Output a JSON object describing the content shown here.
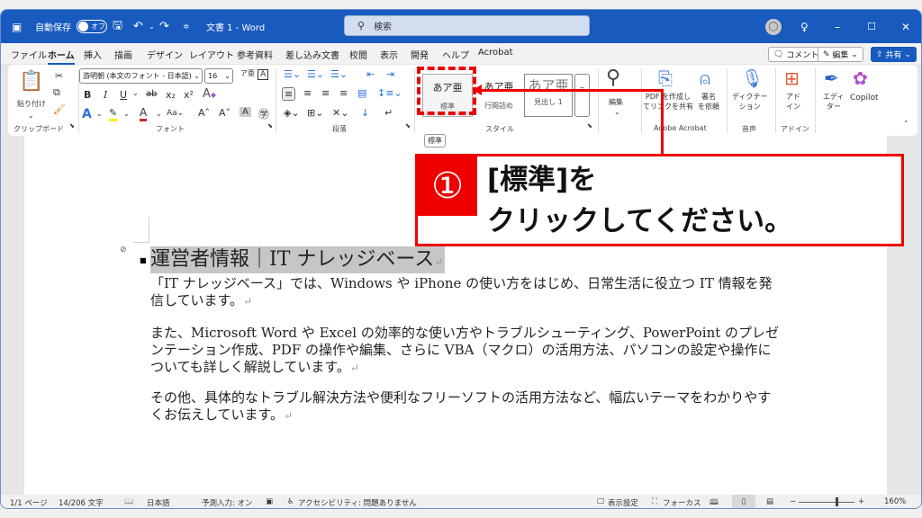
{
  "titlebar": {
    "autosave_label": "自動保存",
    "autosave_state": "オフ",
    "doc_title": "文書 1  -  Word",
    "search_placeholder": "検索",
    "icons": [
      "word-logo-icon",
      "save-icon",
      "undo-icon",
      "redo-icon",
      "customize-icon",
      "account-icon",
      "lightbulb-icon",
      "minimize-icon",
      "maximize-icon",
      "close-icon"
    ]
  },
  "menu": {
    "tabs": [
      "ファイル",
      "ホーム",
      "挿入",
      "描画",
      "デザイン",
      "レイアウト",
      "参考資料",
      "差し込み文書",
      "校閲",
      "表示",
      "開発",
      "ヘルプ",
      "Acrobat"
    ],
    "active_tab": "ホーム",
    "comment_label": "コメント",
    "edit_label": "編集",
    "share_label": "共有"
  },
  "ribbon": {
    "clipboard": {
      "paste_label": "貼り付け",
      "group_label": "クリップボード"
    },
    "font": {
      "font_name": "游明朝 (本文のフォント - 日本語)",
      "font_size": "16",
      "group_label": "フォント"
    },
    "paragraph": {
      "group_label": "段落"
    },
    "styles": {
      "items": [
        {
          "preview": "あア亜",
          "name": "標準"
        },
        {
          "preview": "あア亜",
          "name": "行間詰め"
        },
        {
          "preview": "あア亜",
          "name": "見出し 1"
        }
      ],
      "group_label": "スタイル",
      "tooltip": "標準"
    },
    "editing": {
      "label": "編集"
    },
    "acrobat": {
      "create_pdf_label": "PDF を作成し\nてリンクを共有",
      "sign_label": "署名\nを依頼",
      "group_label": "Adobe Acrobat"
    },
    "voice": {
      "dictate_label": "ディクテー\nション",
      "group_label": "音声"
    },
    "addins": {
      "label": "アド\nイン",
      "group_label": "アドイン"
    },
    "editor": {
      "label": "エディ\nター"
    },
    "copilot": {
      "label": "Copilot"
    }
  },
  "document": {
    "heading": "運営者情報｜IT ナレッジベース",
    "paragraphs": [
      "「IT ナレッジベース」では、Windows や iPhone の使い方をはじめ、日常生活に役立つ IT 情報を発信しています。",
      "また、Microsoft Word や Excel の効率的な使い方やトラブルシューティング、PowerPoint のプレゼンテーション作成、PDF の操作や編集、さらに VBA（マクロ）の活用方法、パソコンの設定や操作についても詳しく解説しています。",
      "その他、具体的なトラブル解決方法や便利なフリーソフトの活用方法など、幅広いテーマをわかりやすくお伝えしています。"
    ],
    "para_mark": "↵"
  },
  "callout": {
    "number": "①",
    "line1": "[標準]を",
    "line2": "クリックしてください。",
    "accent": "#ee0000"
  },
  "status": {
    "page": "1/1 ページ",
    "words": "14/206 文字",
    "language": "日本語",
    "predict": "予測入力: オン",
    "accessibility": "アクセシビリティ: 問題ありません",
    "display_settings": "表示設定",
    "focus": "フォーカス",
    "zoom": "160%",
    "zoom_percent": 160
  }
}
